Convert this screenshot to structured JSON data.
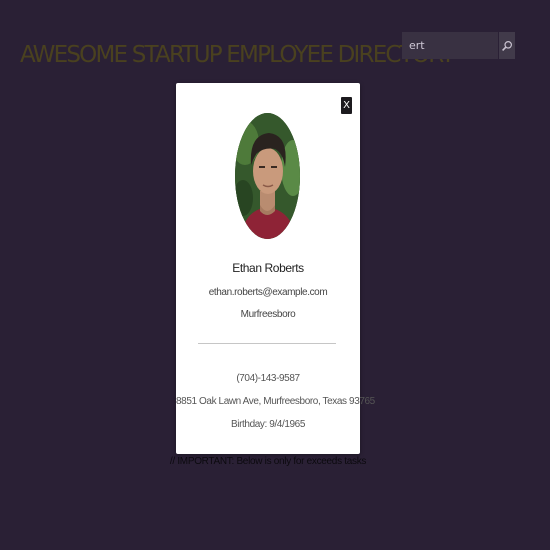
{
  "header": {
    "title": "AWESOME STARTUP EMPLOYEE DIRECTORY"
  },
  "search": {
    "value": "ert",
    "button_icon": "magnifier-icon"
  },
  "note": {
    "text": "// IMPORTANT: Below is only for exceeds tasks"
  },
  "modal": {
    "close_label": "X",
    "employee": {
      "name": "Ethan Roberts",
      "email": "ethan.roberts@example.com",
      "city": "Murfreesboro",
      "phone": "(704)-143-9587",
      "address": "8851 Oak Lawn Ave, Murfreesboro, Texas 93765",
      "birthday": "Birthday: 9/4/1965"
    }
  },
  "colors": {
    "background": "#2a2035",
    "title": "#4a411f",
    "modal_background": "#ffffff",
    "close_button": "#1c1a1e"
  }
}
